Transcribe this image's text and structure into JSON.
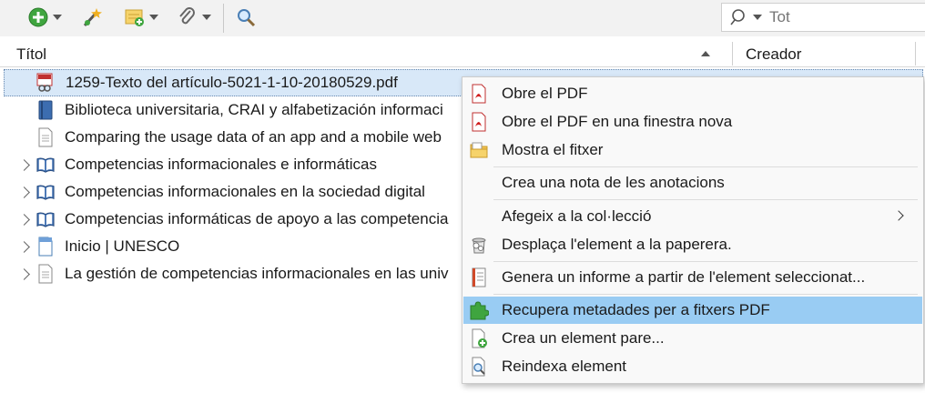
{
  "toolbar": {
    "buttons": [
      {
        "name": "new-item-button",
        "icon": "green-plus-icon"
      },
      {
        "name": "add-by-identifier-button",
        "icon": "magic-wand-icon"
      },
      {
        "name": "new-note-button",
        "icon": "note-icon"
      },
      {
        "name": "add-attachment-button",
        "icon": "paperclip-icon"
      },
      {
        "name": "advanced-search-button",
        "icon": "magnifier-icon"
      }
    ],
    "search": {
      "placeholder": "Tot",
      "value": ""
    }
  },
  "table": {
    "columns": {
      "title": "Títol",
      "creator": "Creador"
    },
    "rows": [
      {
        "title": "1259-Texto del artículo-5021-1-10-20180529.pdf",
        "icon": "pdf-link-icon",
        "selected": true,
        "expandable": false
      },
      {
        "title": "Biblioteca universitaria, CRAI y alfabetización informaci",
        "icon": "book-icon",
        "selected": false,
        "expandable": false
      },
      {
        "title": "Comparing the usage data of an app and a mobile web",
        "icon": "document-icon",
        "selected": false,
        "expandable": false
      },
      {
        "title": "Competencias informacionales e informáticas",
        "icon": "open-book-icon",
        "selected": false,
        "expandable": true
      },
      {
        "title": "Competencias informacionales en la sociedad digital",
        "icon": "open-book-icon",
        "selected": false,
        "expandable": true
      },
      {
        "title": "Competencias informáticas de apoyo a las competencia",
        "icon": "open-book-icon",
        "selected": false,
        "expandable": true
      },
      {
        "title": "Inicio | UNESCO",
        "icon": "webpage-icon",
        "selected": false,
        "expandable": true
      },
      {
        "title": "La gestión de competencias informacionales en las univ",
        "icon": "document-icon",
        "selected": false,
        "expandable": true
      }
    ]
  },
  "context_menu": {
    "items": [
      {
        "label": "Obre el PDF",
        "icon": "pdf-icon"
      },
      {
        "label": "Obre el PDF en una finestra nova",
        "icon": "pdf-icon"
      },
      {
        "label": "Mostra el fitxer",
        "icon": "folder-icon"
      },
      {
        "label": "Crea una nota de les anotacions",
        "icon": ""
      },
      {
        "label": "Afegeix a la col·lecció",
        "icon": "",
        "submenu": true
      },
      {
        "label": "Desplaça l'element a la paperera.",
        "icon": "trash-icon"
      },
      {
        "label": "Genera un informe a partir de l'element seleccionat...",
        "icon": "report-icon"
      },
      {
        "label": "Recupera metadades per a fitxers PDF",
        "icon": "puzzle-icon",
        "highlighted": true
      },
      {
        "label": "Crea un element pare...",
        "icon": "new-parent-icon"
      },
      {
        "label": "Reindexa element",
        "icon": "reindex-icon"
      }
    ]
  }
}
